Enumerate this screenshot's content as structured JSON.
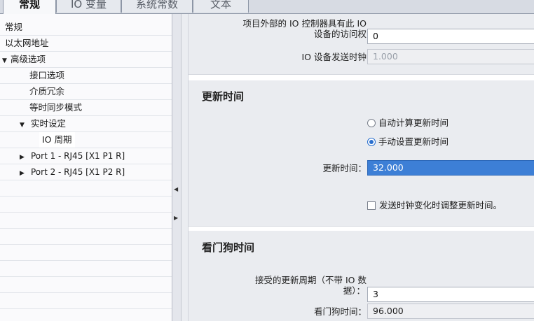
{
  "tabs": [
    {
      "label": "常规",
      "active": true
    },
    {
      "label": "IO 变量",
      "active": false
    },
    {
      "label": "系统常数",
      "active": false
    },
    {
      "label": "文本",
      "active": false
    }
  ],
  "tree": [
    {
      "label": "常规"
    },
    {
      "label": "以太网地址"
    },
    {
      "label": "高级选项",
      "expanded": true
    },
    {
      "label": "接口选项"
    },
    {
      "label": "介质冗余"
    },
    {
      "label": "等时同步模式"
    },
    {
      "label": "实时设定",
      "expanded": true
    },
    {
      "label": "IO 周期",
      "selected": true
    },
    {
      "label": "Port 1 - RJ45 [X1 P1 R]",
      "collapsed": true
    },
    {
      "label": "Port 2 - RJ45 [X1 P2 R]",
      "collapsed": true
    }
  ],
  "top_section": {
    "access_label_line1": "项目外部的 IO 控制器具有此 IO",
    "access_label_line2": "设备的访问权",
    "access_value": "0",
    "send_clock_label": "IO 设备发送时钟",
    "send_clock_value": "1.000"
  },
  "update_time": {
    "title": "更新时间",
    "radio_auto": "自动计算更新时间",
    "radio_manual": "手动设置更新时间",
    "selected": "manual",
    "time_label": "更新时间：",
    "time_value": "32.000",
    "adjust_checkbox": "发送时钟变化时调整更新时间。",
    "adjust_checked": false
  },
  "watchdog": {
    "title": "看门狗时间",
    "cycles_label_line1": "接受的更新周期（不带 IO 数",
    "cycles_label_line2": "据）：",
    "cycles_value": "3",
    "time_label": "看门狗时间：",
    "time_value": "96.000"
  },
  "icons": {
    "expanded": "triangle-down",
    "collapsed": "triangle-right",
    "splitter_left": "triangle-left",
    "splitter_right": "triangle-right"
  }
}
